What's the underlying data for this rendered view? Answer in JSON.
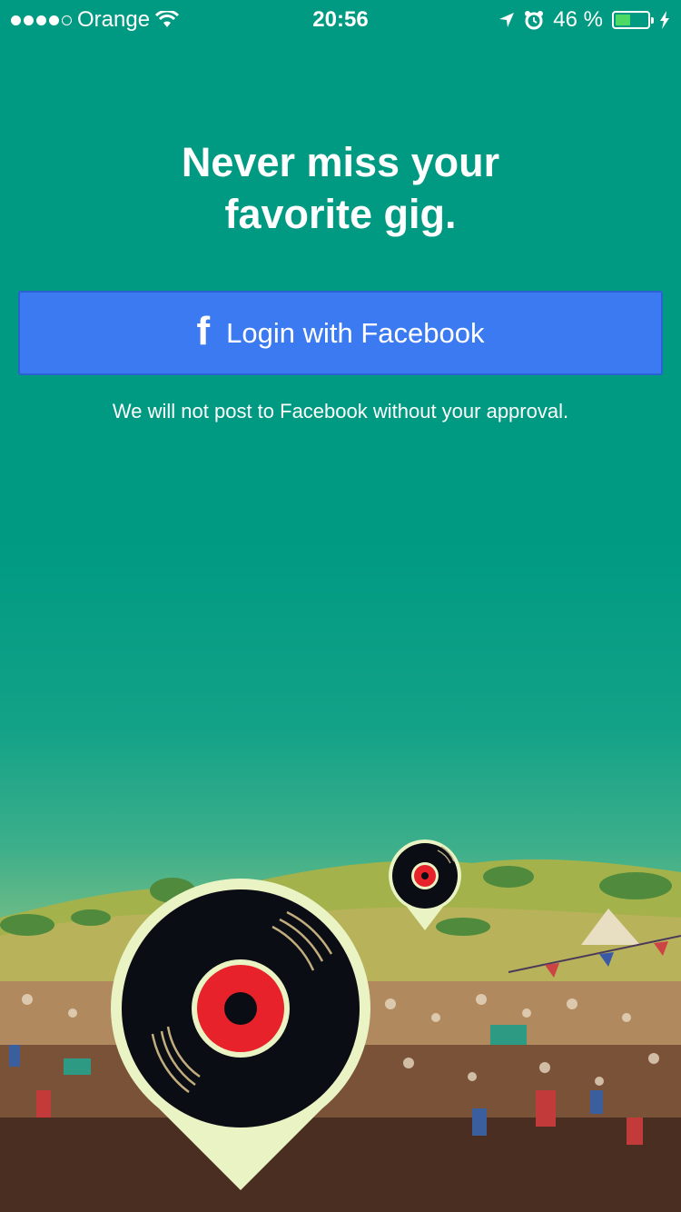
{
  "status_bar": {
    "carrier": "Orange",
    "time": "20:56",
    "battery_text": "46 %",
    "battery_level": 0.46,
    "icons": [
      "signal-dots-icon",
      "wifi-icon",
      "location-arrow-icon",
      "alarm-icon",
      "battery-icon",
      "charging-bolt-icon"
    ]
  },
  "headline": {
    "line1": "Never miss your",
    "line2": "favorite gig."
  },
  "login": {
    "icon": "facebook-f-icon",
    "label": "Login with Facebook"
  },
  "disclaimer": "We will not post to Facebook without your approval.",
  "colors": {
    "background": "#009a82",
    "facebook_button": "#3b7af0",
    "record_label": "#e8222a",
    "pin": "#e9f3c4"
  }
}
